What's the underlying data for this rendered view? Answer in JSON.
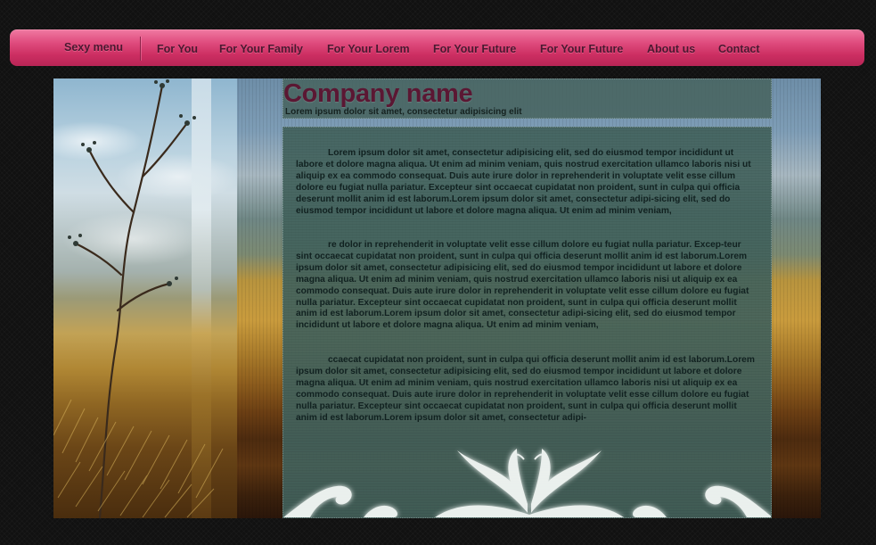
{
  "nav": {
    "brand": "Sexy menu",
    "items": [
      {
        "label": "For You"
      },
      {
        "label": "For Your Family"
      },
      {
        "label": "For Your Lorem"
      },
      {
        "label": "For Your Future"
      },
      {
        "label": "For Your Future"
      },
      {
        "label": "About us"
      },
      {
        "label": "Contact"
      }
    ]
  },
  "header": {
    "company_name": "Company name",
    "slogan": "Lorem ipsum dolor sit amet, consectetur adipisicing elit"
  },
  "content": {
    "paragraphs": [
      "Lorem ipsum dolor sit amet, consectetur adipisicing elit, sed do eiusmod tempor incididunt ut labore et dolore magna aliqua. Ut enim ad minim veniam, quis nostrud exercitation ullamco laboris nisi ut aliquip ex ea commodo consequat. Duis aute irure dolor in reprehenderit in voluptate velit esse cillum dolore eu fugiat nulla pariatur. Excepteur sint occaecat cupidatat non proident, sunt in culpa qui officia deserunt mollit anim id est laborum.Lorem ipsum dolor sit amet, consectetur adipi-sicing elit, sed do eiusmod tempor incididunt ut labore et dolore magna aliqua. Ut enim ad minim veniam,",
      "re dolor in reprehenderit in voluptate velit esse cillum dolore eu fugiat nulla pariatur. Excep-teur sint occaecat cupidatat non proident, sunt in culpa qui officia deserunt mollit anim id est laborum.Lorem ipsum dolor sit amet, consectetur adipisicing elit, sed do eiusmod tempor incididunt ut labore et dolore magna aliqua. Ut enim ad minim veniam, quis nostrud exercitation ullamco laboris nisi ut aliquip ex ea commodo consequat. Duis aute irure dolor in reprehenderit in voluptate velit esse cillum dolore eu fugiat nulla pariatur. Excepteur sint occaecat cupidatat non proident, sunt in culpa qui officia deserunt mollit anim id est laborum.Lorem ipsum dolor sit amet, consectetur adipi-sicing elit, sed do eiusmod tempor incididunt ut labore et dolore magna aliqua. Ut enim ad minim veniam,",
      "ccaecat cupidatat non proident, sunt in culpa qui officia deserunt mollit anim id est laborum.Lorem ipsum dolor sit amet, consectetur adipisicing elit, sed do eiusmod tempor incididunt ut labore et dolore magna aliqua. Ut enim ad minim veniam, quis nostrud exercitation ullamco laboris nisi ut aliquip ex ea commodo consequat. Duis aute irure dolor in reprehenderit in voluptate velit esse cillum dolore eu fugiat nulla pariatur. Excepteur sint occaecat cupidatat non proident, sunt in culpa qui officia deserunt mollit anim id est laborum.Lorem ipsum dolor sit amet, consectetur adipi-"
    ]
  },
  "colors": {
    "nav_bar": "#d93a6e",
    "nav_text": "#4a1830",
    "company_name": "#5b1733",
    "panel": "#42625c",
    "background": "#111111"
  },
  "icons": {
    "decoration": "butterfly-icon"
  }
}
